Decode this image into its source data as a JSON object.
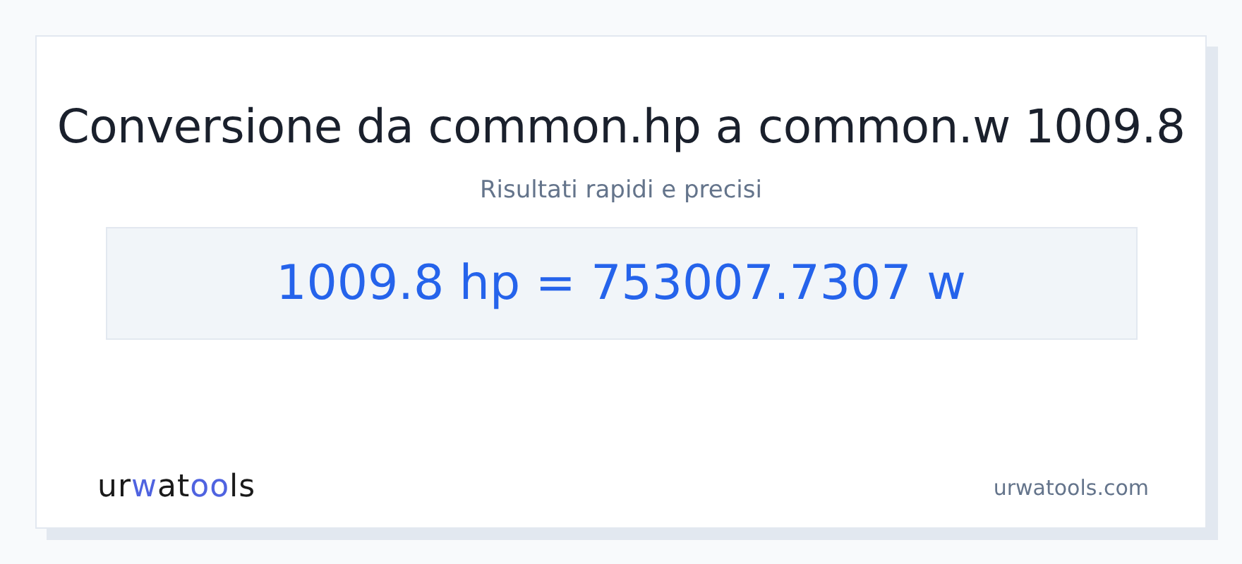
{
  "title": "Conversione da common.hp a common.w 1009.8",
  "subtitle": "Risultati rapidi e precisi",
  "result": "1009.8 hp = 753007.7307 w",
  "logo": [
    {
      "text": "ur",
      "accent": false
    },
    {
      "text": "w",
      "accent": true
    },
    {
      "text": "at",
      "accent": false
    },
    {
      "text": "oo",
      "accent": true
    },
    {
      "text": "ls",
      "accent": false
    }
  ],
  "site": "urwatools.com"
}
